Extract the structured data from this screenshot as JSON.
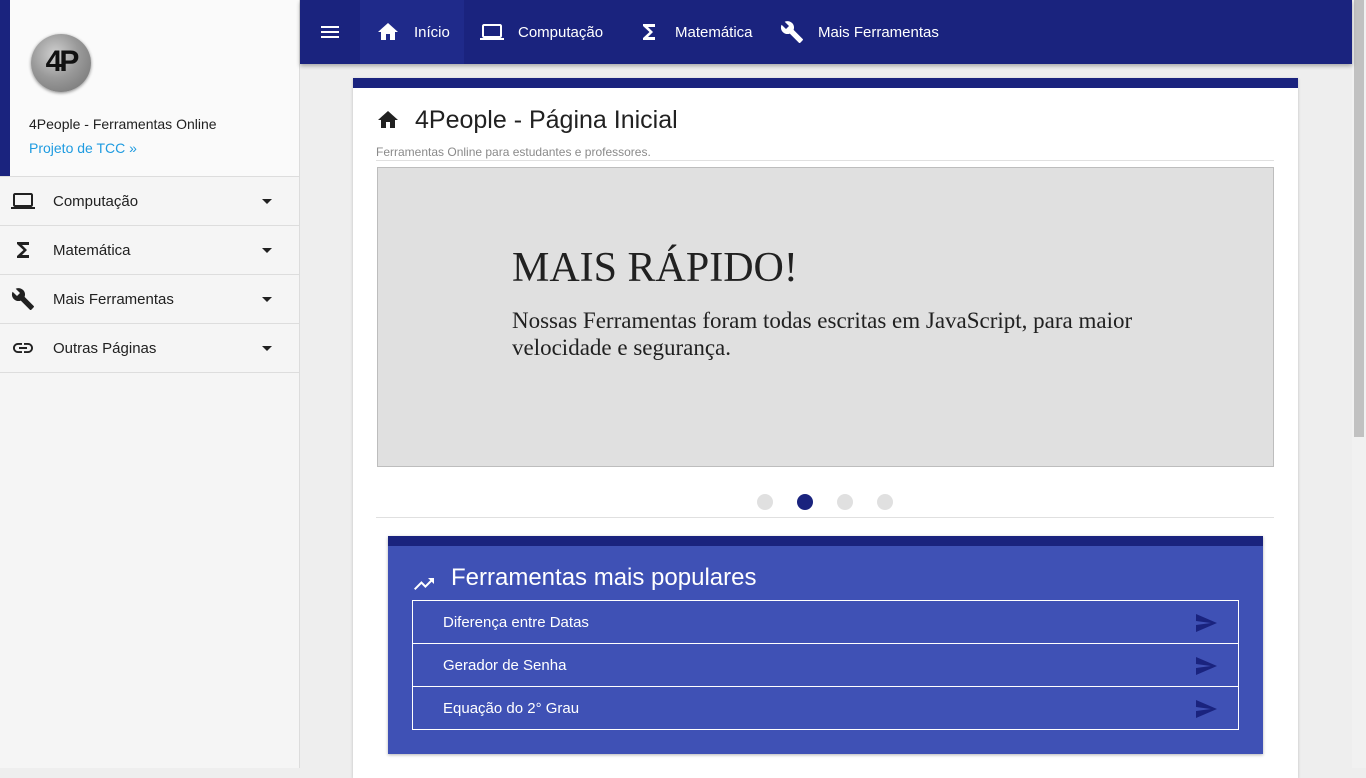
{
  "brand": {
    "logo_text": "4P",
    "name": "4People - Ferramentas Online",
    "link": "Projeto de TCC »"
  },
  "sidebar": {
    "items": [
      {
        "label": "Computação",
        "icon": "laptop-icon"
      },
      {
        "label": "Matemática",
        "icon": "sigma-icon"
      },
      {
        "label": "Mais Ferramentas",
        "icon": "wrench-icon"
      },
      {
        "label": "Outras Páginas",
        "icon": "link-icon"
      }
    ]
  },
  "topbar": {
    "menu_icon": "menu-icon",
    "nav": [
      {
        "label": "Início",
        "icon": "home-icon",
        "active": true
      },
      {
        "label": "Computação",
        "icon": "laptop-icon"
      },
      {
        "label": "Matemática",
        "icon": "sigma-icon"
      },
      {
        "label": "Mais Ferramentas",
        "icon": "wrench-icon"
      }
    ]
  },
  "page": {
    "title": "4People - Página Inicial",
    "subtitle": "Ferramentas Online para estudantes e professores."
  },
  "carousel": {
    "title": "MAIS RÁPIDO!",
    "text": "Nossas Ferramentas foram todas escritas em JavaScript, para maior velocidade e segurança.",
    "slide_count": 4,
    "active_index": 1
  },
  "popular": {
    "title": "Ferramentas mais populares",
    "icon": "trending-up-icon",
    "items": [
      {
        "label": "Diferença entre Datas"
      },
      {
        "label": "Gerador de Senha"
      },
      {
        "label": "Equação do 2° Grau"
      }
    ]
  },
  "colors": {
    "primary": "#1a237e",
    "accent": "#3f51b5",
    "link": "#1e9be0",
    "background": "#eeeeee"
  }
}
